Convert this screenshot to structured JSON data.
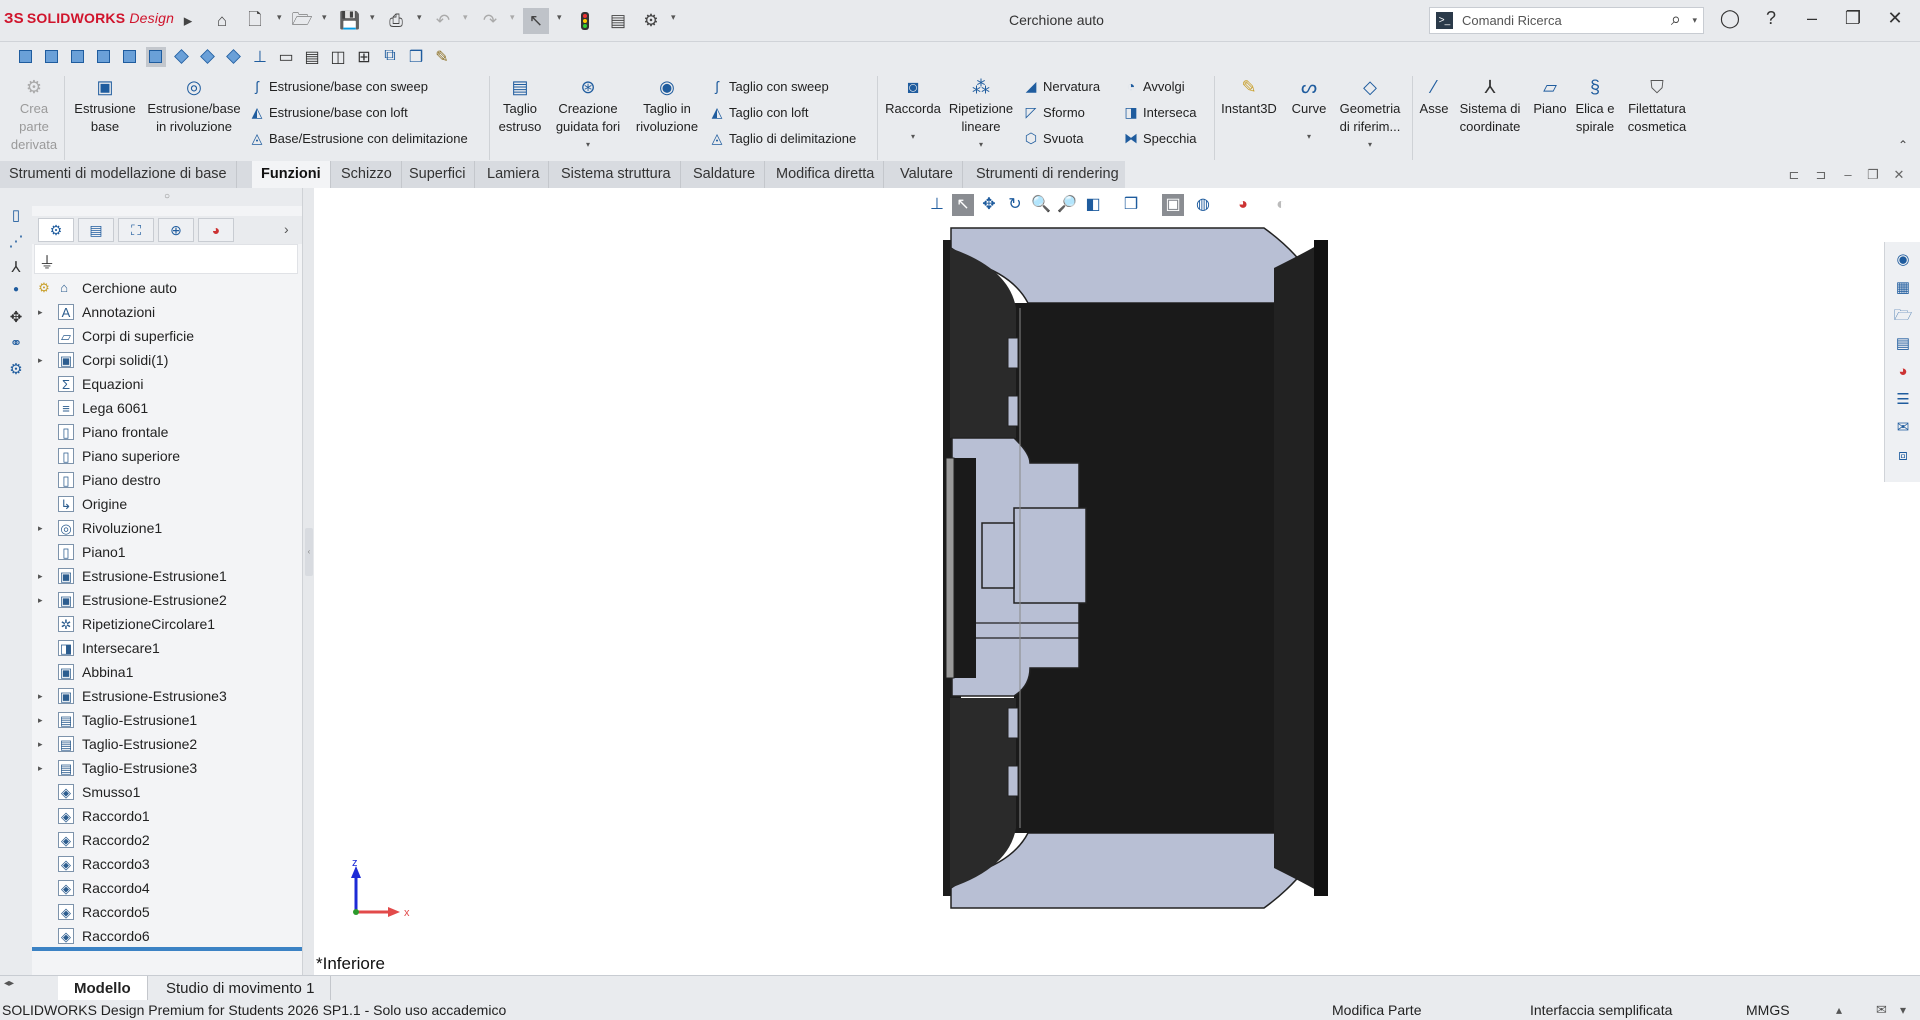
{
  "app": {
    "logo_brand": "SOLIDWORKS",
    "logo_suffix": "Design",
    "document_title": "Cerchione auto"
  },
  "search": {
    "placeholder": "Comandi Ricerca"
  },
  "colors": {
    "accent": "#1f5c9e",
    "brand_red": "#d0142c",
    "part_body": "#b8bfd4",
    "part_dark": "#1b1b1b",
    "selection": "#3b82c4"
  },
  "command_manager": {
    "crea_parte_derivata": "Crea parte derivata",
    "estrusione_base": "Estrusione base",
    "estrusione_rivoluzione": "Estrusione/base in rivoluzione",
    "sweep": "Estrusione/base con sweep",
    "loft": "Estrusione/base con loft",
    "delimitazione": "Base/Estrusione con delimitazione",
    "taglio_estruso": "Taglio estruso",
    "creazione_fori": "Creazione guidata fori",
    "taglio_rivoluzione": "Taglio in rivoluzione",
    "taglio_sweep": "Taglio con sweep",
    "taglio_loft": "Taglio con loft",
    "taglio_delimitazione": "Taglio di delimitazione",
    "raccorda": "Raccorda",
    "ripetizione": "Ripetizione lineare",
    "nervatura": "Nervatura",
    "sformo": "Sformo",
    "svuota": "Svuota",
    "avvolgi": "Avvolgi",
    "interseca": "Interseca",
    "specchia": "Specchia",
    "instant3d": "Instant3D",
    "curve": "Curve",
    "geometria": "Geometria di riferim...",
    "asse": "Asse",
    "sistema_coordinate": "Sistema di coordinate",
    "piano": "Piano",
    "elica": "Elica e spirale",
    "filettatura": "Filettatura cosmetica"
  },
  "tabs": [
    "Strumenti di modellazione di base",
    "Funzioni",
    "Schizzo",
    "Superfici",
    "Lamiera",
    "Sistema struttura",
    "Saldature",
    "Modifica diretta",
    "Valutare",
    "Strumenti di rendering"
  ],
  "feature_tree": {
    "root": "Cerchione auto",
    "items": [
      {
        "label": "Annotazioni",
        "icon": "A",
        "expandable": true
      },
      {
        "label": "Corpi di superficie",
        "icon": "▱",
        "expandable": false
      },
      {
        "label": "Corpi solidi(1)",
        "icon": "▣",
        "expandable": true
      },
      {
        "label": "Equazioni",
        "icon": "Σ",
        "expandable": false
      },
      {
        "label": "Lega 6061",
        "icon": "≡",
        "expandable": false
      },
      {
        "label": "Piano frontale",
        "icon": "▯",
        "expandable": false
      },
      {
        "label": "Piano superiore",
        "icon": "▯",
        "expandable": false
      },
      {
        "label": "Piano destro",
        "icon": "▯",
        "expandable": false
      },
      {
        "label": "Origine",
        "icon": "↳",
        "expandable": false
      },
      {
        "label": "Rivoluzione1",
        "icon": "◎",
        "expandable": true
      },
      {
        "label": "Piano1",
        "icon": "▯",
        "expandable": false
      },
      {
        "label": "Estrusione-Estrusione1",
        "icon": "▣",
        "expandable": true
      },
      {
        "label": "Estrusione-Estrusione2",
        "icon": "▣",
        "expandable": true
      },
      {
        "label": "RipetizioneCircolare1",
        "icon": "✲",
        "expandable": false
      },
      {
        "label": "Intersecare1",
        "icon": "◨",
        "expandable": false
      },
      {
        "label": "Abbina1",
        "icon": "▣",
        "expandable": false
      },
      {
        "label": "Estrusione-Estrusione3",
        "icon": "▣",
        "expandable": true
      },
      {
        "label": "Taglio-Estrusione1",
        "icon": "▤",
        "expandable": true
      },
      {
        "label": "Taglio-Estrusione2",
        "icon": "▤",
        "expandable": true
      },
      {
        "label": "Taglio-Estrusione3",
        "icon": "▤",
        "expandable": true
      },
      {
        "label": "Smusso1",
        "icon": "◈",
        "expandable": false
      },
      {
        "label": "Raccordo1",
        "icon": "◈",
        "expandable": false
      },
      {
        "label": "Raccordo2",
        "icon": "◈",
        "expandable": false
      },
      {
        "label": "Raccordo3",
        "icon": "◈",
        "expandable": false
      },
      {
        "label": "Raccordo4",
        "icon": "◈",
        "expandable": false
      },
      {
        "label": "Raccordo5",
        "icon": "◈",
        "expandable": false
      },
      {
        "label": "Raccordo6",
        "icon": "◈",
        "expandable": false
      }
    ]
  },
  "viewport": {
    "view_name": "*Inferiore",
    "axis_z": "z",
    "axis_x": "x"
  },
  "model_tabs": [
    "Modello",
    "Studio di movimento 1"
  ],
  "status": {
    "product": "SOLIDWORKS Design Premium for Students 2026 SP1.1 - Solo uso accademico",
    "mode": "Modifica Parte",
    "interface": "Interfaccia semplificata",
    "units": "MMGS"
  }
}
